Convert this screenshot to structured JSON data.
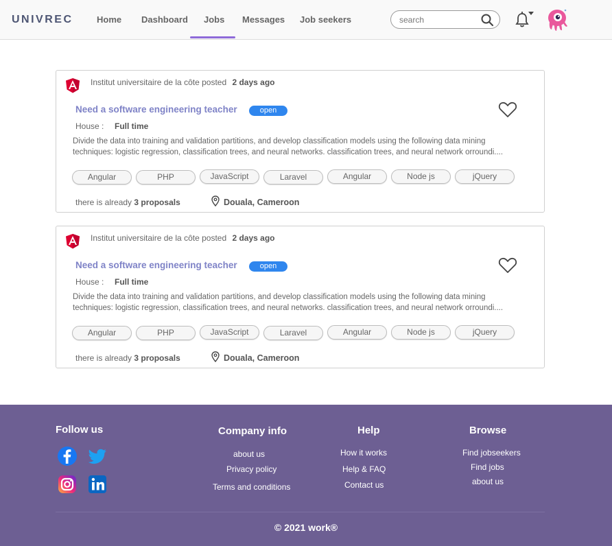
{
  "header": {
    "brand": "UNIVREC",
    "nav": [
      "Home",
      "Dashboard",
      "Jobs",
      "Messages",
      "Job seekers"
    ],
    "active_nav": "Jobs",
    "search_placeholder": "search"
  },
  "jobs": [
    {
      "company": "Institut universitaire de la côte",
      "posted_word": "posted",
      "posted_time": "2 days ago",
      "title": "Need a software engineering teacher",
      "status": "open",
      "house_label": "House :",
      "house_value": "Full time",
      "description_line1": "Divide the data into training and validation partitions, and develop classification models using the following data mining",
      "description_line2": "techniques: logistic regression, classification trees, and neural networks. classification trees, and neural network orroundi....",
      "tags": [
        "Angular",
        "PHP",
        "JavaScript",
        "Laravel",
        "Angular",
        "Node js",
        "jQuery"
      ],
      "proposals_prefix": "there is already",
      "proposals_count": "3 proposals",
      "location": "Douala, Cameroon"
    },
    {
      "company": "Institut universitaire de la côte",
      "posted_word": "posted",
      "posted_time": "2 days ago",
      "title": "Need a software engineering teacher",
      "status": "open",
      "house_label": "House :",
      "house_value": "Full time",
      "description_line1": "Divide the data into training and validation partitions, and develop classification models using the following data mining",
      "description_line2": "techniques: logistic regression, classification trees, and neural networks. classification trees, and neural network orroundi....",
      "tags": [
        "Angular",
        "PHP",
        "JavaScript",
        "Laravel",
        "Angular",
        "Node js",
        "jQuery"
      ],
      "proposals_prefix": "there is already",
      "proposals_count": "3 proposals",
      "location": "Douala, Cameroon"
    }
  ],
  "footer": {
    "follow_heading": "Follow us",
    "social_icons": [
      "facebook-icon",
      "twitter-icon",
      "instagram-icon",
      "linkedin-icon"
    ],
    "company_heading": "Company info",
    "company_links": [
      "about us",
      "Privacy policy",
      "Terms and conditions"
    ],
    "help_heading": "Help",
    "help_links": [
      "How it works",
      "Help & FAQ",
      "Contact us"
    ],
    "browse_heading": "Browse",
    "browse_links": [
      "Find jobseekers",
      "Find jobs",
      "about us"
    ],
    "copyright": "©  2021 work®"
  },
  "colors": {
    "accent": "#8e6ad9",
    "title": "#7f83c7",
    "badge": "#2f86ee",
    "footer": "#6d5f93"
  }
}
